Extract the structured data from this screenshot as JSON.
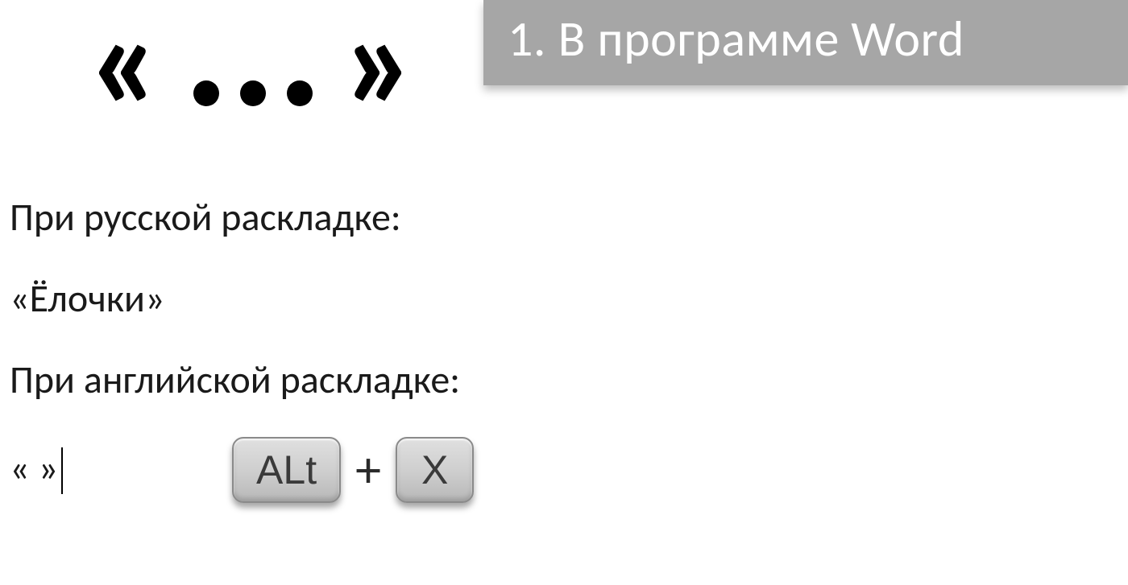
{
  "header": {
    "title": "1. В программе Word",
    "symbol_open": "«",
    "symbol_close": "»"
  },
  "content": {
    "russian_label": "При русской раскладке:",
    "russian_example": "«Ёлочки»",
    "english_label": "При английской раскладке:",
    "english_example": "«   »"
  },
  "keys": {
    "key1": "ALt",
    "plus": "+",
    "key2": "X"
  }
}
